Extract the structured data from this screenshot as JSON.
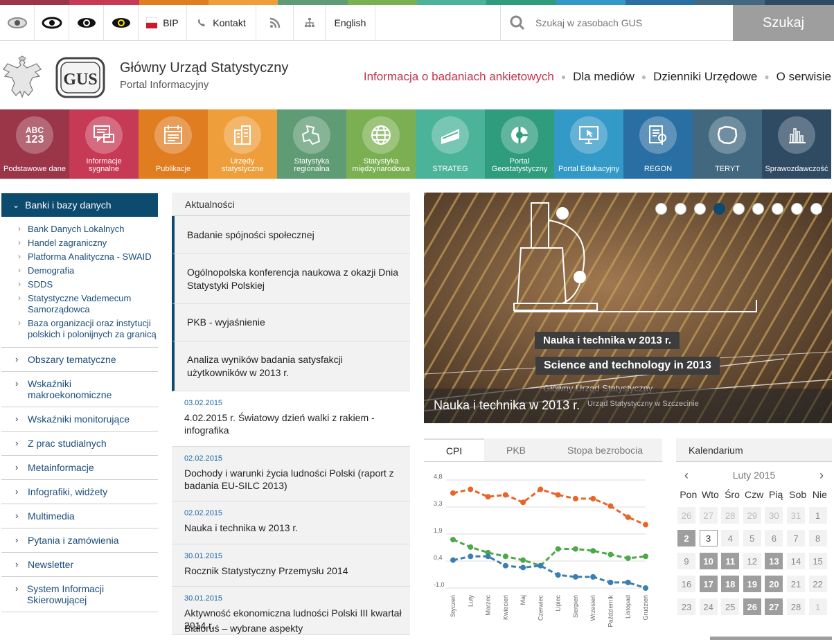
{
  "topbar": {
    "bip_label": "BIP",
    "contact_label": "Kontakt",
    "english_label": "English",
    "search_placeholder": "Szukaj w zasobach GUS",
    "search_button": "Szukaj",
    "contrast_colors": [
      "#dddddd",
      "#ffffff",
      "#222222",
      "#f5e600"
    ]
  },
  "header": {
    "title": "Główny Urząd Statystyczny",
    "subtitle": "Portal Informacyjny",
    "logo_text": "GUS",
    "nav": [
      "Informacja o badaniach ankietowych",
      "Dla mediów",
      "Dzienniki Urzędowe",
      "O serwisie"
    ],
    "active_color": "#c2334a"
  },
  "tiles": [
    {
      "label": "Podstawowe dane",
      "icon": "abc-123-icon",
      "color": "#9b3649"
    },
    {
      "label": "Informacje sygnalne",
      "icon": "chat-icon",
      "color": "#c73a55"
    },
    {
      "label": "Publikacje",
      "icon": "calendar-icon",
      "color": "#e07d20"
    },
    {
      "label": "Urzędy statystyczne",
      "icon": "buildings-icon",
      "color": "#ee9f3c"
    },
    {
      "label": "Statystyka regionalna",
      "icon": "regions-map-icon",
      "color": "#5f9b74"
    },
    {
      "label": "Statystyka międzynarodowa",
      "icon": "globe-icon",
      "color": "#7bb052"
    },
    {
      "label": "STRATEG",
      "icon": "strateg-icon",
      "color": "#4cb39b"
    },
    {
      "label": "Portal Geostatystyczny",
      "icon": "geo-icon",
      "color": "#2e9c7d"
    },
    {
      "label": "Portal Edukacyjny",
      "icon": "monitor-cursor-icon",
      "color": "#3399c6"
    },
    {
      "label": "REGON",
      "icon": "document-search-icon",
      "color": "#2a6fa3"
    },
    {
      "label": "TERYT",
      "icon": "poland-map-icon",
      "color": "#41687f"
    },
    {
      "label": "Sprawozdawczość",
      "icon": "bar-chart-icon",
      "color": "#2f4a63"
    }
  ],
  "sidebar": {
    "active": "Banki i bazy danych",
    "sub_items": [
      "Bank Danych Lokalnych",
      "Handel zagraniczny",
      "Platforma Analityczna - SWAID",
      "Demografia",
      "SDDS",
      "Statystyczne Vademecum Samorządowca",
      "Baza organizacji oraz instytucji polskich i polonijnych za granicą"
    ],
    "items": [
      "Obszary tematyczne",
      "Wskaźniki makroekonomiczne",
      "Wskaźniki monitorujące",
      "Z prac studialnych",
      "Metainformacje",
      "Infografiki, widżety",
      "Multimedia",
      "Pytania i zamówienia",
      "Newsletter",
      "System Informacji Skierowującej"
    ]
  },
  "news": {
    "header": "Aktualności",
    "featured": [
      "Badanie spójności społecznej",
      "Ogólnopolska konferencja naukowa z okazji Dnia Statystyki Polskiej",
      "PKB - wyjaśnienie",
      "Analiza wyników badania satysfakcji użytkowników w 2013 r."
    ],
    "items": [
      {
        "date": "03.02.2015",
        "title": "4.02.2015 r. Światowy dzień walki z rakiem - infografika"
      },
      {
        "date": "02.02.2015",
        "title": "Dochody i warunki życia ludności Polski (raport z badania EU-SILC 2013)"
      },
      {
        "date": "02.02.2015",
        "title": "Nauka i technika w 2013 r."
      },
      {
        "date": "30.01.2015",
        "title": "Rocznik Statystyczny Przemysłu 2014"
      },
      {
        "date": "30.01.2015",
        "title": "Aktywność ekonomiczna ludności Polski III kwartał 2014 r."
      },
      {
        "date": "",
        "title": "Białoruś – wybrane aspekty"
      }
    ]
  },
  "slider": {
    "caption": "Nauka i technika w 2013 r.",
    "banner_pl": "Nauka i technika w 2013 r.",
    "banner_en": "Science and technology in 2013",
    "org_line": "Główny Urząd Statystyczny",
    "org_line2": "Urząd Statystyczny w Szczecinie",
    "dot_count": 9,
    "active_dot": 4
  },
  "chart_tabs": [
    "CPI",
    "PKB",
    "Stopa bezrobocia"
  ],
  "chart_data": {
    "type": "line",
    "categories": [
      "Styczeń",
      "Luty",
      "Marzec",
      "Kwiecień",
      "Maj",
      "Czerwiec",
      "Lipiec",
      "Sierpień",
      "Wrzesień",
      "Październik",
      "Listopad",
      "Grudzień"
    ],
    "yticks": [
      "4,8",
      "3,3",
      "1,9",
      "0,4",
      "-1,0"
    ],
    "ylim": [
      -1.0,
      4.8
    ],
    "grid": true,
    "series": [
      {
        "color": "#e8652a",
        "values": [
          4.1,
          4.3,
          3.9,
          4.0,
          3.6,
          4.3,
          4.0,
          3.8,
          3.8,
          3.4,
          2.8,
          2.4
        ]
      },
      {
        "color": "#4da84a",
        "values": [
          1.6,
          1.2,
          0.9,
          0.7,
          0.5,
          0.2,
          1.1,
          1.1,
          1.0,
          0.8,
          0.6,
          0.7
        ]
      },
      {
        "color": "#3a7fb0",
        "values": [
          0.5,
          0.7,
          0.7,
          0.2,
          0.1,
          0.2,
          -0.3,
          -0.4,
          -0.4,
          -0.7,
          -0.7,
          -1.0
        ]
      }
    ]
  },
  "calendar": {
    "header": "Kalendarium",
    "month": "Luty 2015",
    "dow": [
      "Pon",
      "Wto",
      "Śro",
      "Czw",
      "Pią",
      "Sob",
      "Nie"
    ],
    "days": [
      {
        "d": "26",
        "t": "dim"
      },
      {
        "d": "27",
        "t": "dim"
      },
      {
        "d": "28",
        "t": "dim"
      },
      {
        "d": "29",
        "t": "dim"
      },
      {
        "d": "30",
        "t": "dim"
      },
      {
        "d": "31",
        "t": "dim"
      },
      {
        "d": "1",
        "t": "norm"
      },
      {
        "d": "2",
        "t": "ev"
      },
      {
        "d": "3",
        "t": "today"
      },
      {
        "d": "4",
        "t": "norm"
      },
      {
        "d": "5",
        "t": "norm"
      },
      {
        "d": "6",
        "t": "norm"
      },
      {
        "d": "7",
        "t": "norm"
      },
      {
        "d": "8",
        "t": "norm"
      },
      {
        "d": "9",
        "t": "norm"
      },
      {
        "d": "10",
        "t": "ev"
      },
      {
        "d": "11",
        "t": "ev"
      },
      {
        "d": "12",
        "t": "norm"
      },
      {
        "d": "13",
        "t": "ev"
      },
      {
        "d": "14",
        "t": "norm"
      },
      {
        "d": "15",
        "t": "norm"
      },
      {
        "d": "16",
        "t": "norm"
      },
      {
        "d": "17",
        "t": "ev"
      },
      {
        "d": "18",
        "t": "ev"
      },
      {
        "d": "19",
        "t": "ev"
      },
      {
        "d": "20",
        "t": "ev"
      },
      {
        "d": "21",
        "t": "norm"
      },
      {
        "d": "22",
        "t": "norm"
      },
      {
        "d": "23",
        "t": "norm"
      },
      {
        "d": "24",
        "t": "norm"
      },
      {
        "d": "25",
        "t": "norm"
      },
      {
        "d": "26",
        "t": "ev"
      },
      {
        "d": "27",
        "t": "ev"
      },
      {
        "d": "28",
        "t": "norm"
      },
      {
        "d": "1",
        "t": "dim"
      }
    ]
  }
}
